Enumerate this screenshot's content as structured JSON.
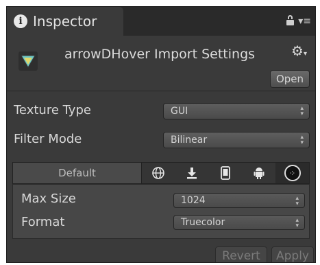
{
  "window": {
    "tab_label": "Inspector"
  },
  "header": {
    "title": "arrowDHover Import Settings",
    "open_label": "Open"
  },
  "properties": [
    {
      "label": "Texture Type",
      "value": "GUI"
    },
    {
      "label": "Filter Mode",
      "value": "Bilinear"
    }
  ],
  "platform_tabs": {
    "default_label": "Default",
    "icons": [
      "globe-icon",
      "download-icon",
      "phone-icon",
      "android-icon",
      "blackberry-icon"
    ]
  },
  "platform_properties": [
    {
      "label": "Max Size",
      "value": "1024"
    },
    {
      "label": "Format",
      "value": "Truecolor"
    }
  ],
  "footer": {
    "revert_label": "Revert",
    "apply_label": "Apply"
  }
}
